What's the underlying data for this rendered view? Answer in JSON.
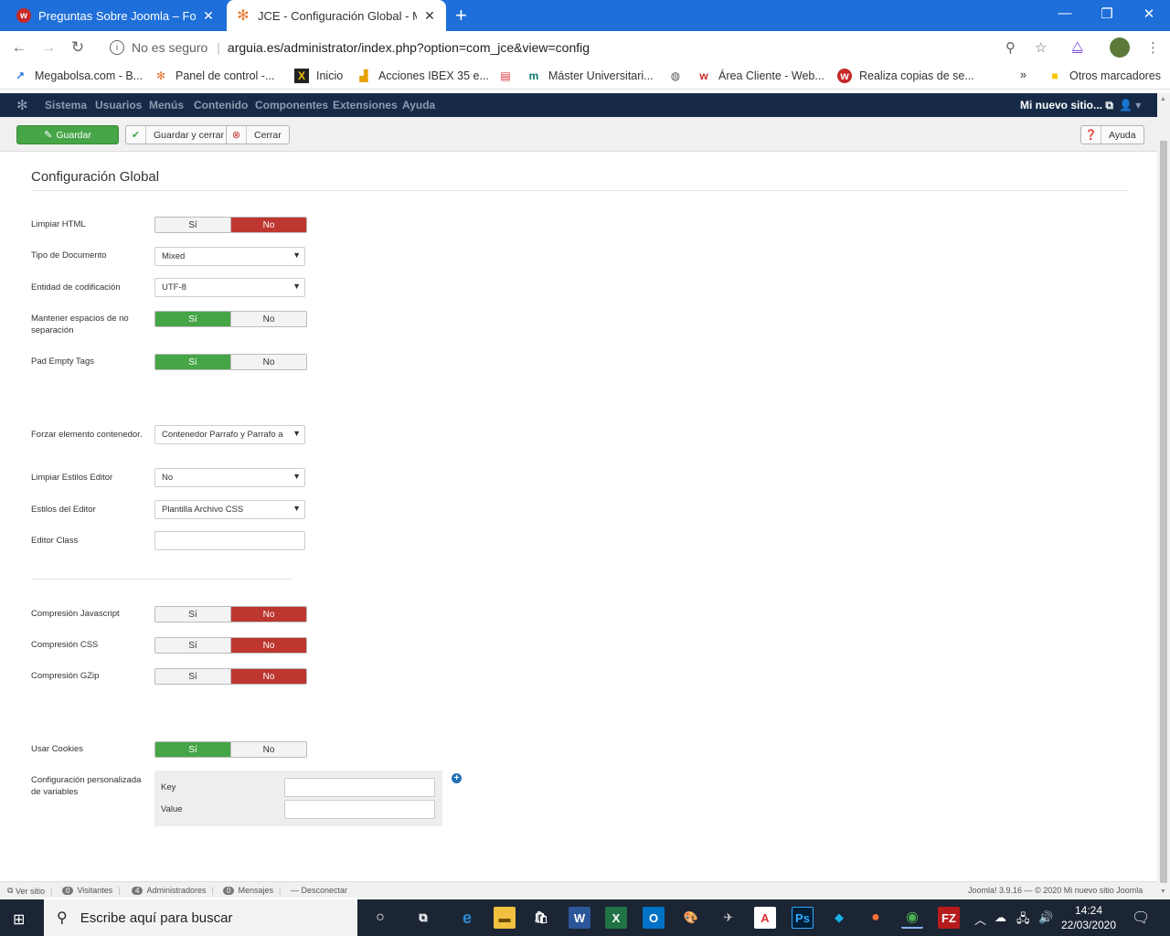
{
  "browser": {
    "tabs": [
      {
        "title": "Preguntas Sobre Joomla – Foro W",
        "active": false
      },
      {
        "title": "JCE - Configuración Global - Mi n",
        "active": true
      }
    ],
    "security_label": "No es seguro",
    "url": "arguia.es/administrator/index.php?option=com_jce&view=config",
    "bookmarks": [
      {
        "label": "Megabolsa.com - B..."
      },
      {
        "label": "Panel de control -..."
      },
      {
        "label": "Inicio"
      },
      {
        "label": "Acciones IBEX 35 e..."
      },
      {
        "label": ""
      },
      {
        "label": "Máster Universitari..."
      },
      {
        "label": ""
      },
      {
        "label": "Área Cliente - Web..."
      },
      {
        "label": "Realiza copias de se..."
      }
    ],
    "bookmarks_overflow": "»",
    "other_bookmarks": "Otros marcadores"
  },
  "joomla_nav": {
    "items": [
      "Sistema",
      "Usuarios",
      "Menús",
      "Contenido",
      "Componentes",
      "Extensiones",
      "Ayuda"
    ],
    "site_link": "Mi nuevo sitio..."
  },
  "toolbar": {
    "save": "Guardar",
    "save_close": "Guardar y cerrar",
    "close": "Cerrar",
    "help": "Ayuda"
  },
  "page": {
    "title": "Configuración Global"
  },
  "form": {
    "limpiar_html": {
      "label": "Limpiar HTML",
      "yes": "Sí",
      "no": "No",
      "value": "No"
    },
    "tipo_documento": {
      "label": "Tipo de Documento",
      "value": "Mixed"
    },
    "entidad_codificacion": {
      "label": "Entidad de codificación",
      "value": "UTF-8"
    },
    "mantener_espacios": {
      "label": "Mantener espacios de no separación",
      "yes": "Sí",
      "no": "No",
      "value": "Sí"
    },
    "pad_empty_tags": {
      "label": "Pad Empty Tags",
      "yes": "Sí",
      "no": "No",
      "value": "Sí"
    },
    "forzar_elemento": {
      "label": "Forzar elemento contenedor.",
      "value": "Contenedor Parrafo y Parrafo a"
    },
    "limpiar_estilos": {
      "label": "Limpiar Estilos Editor",
      "value": "No"
    },
    "estilos_editor": {
      "label": "Estilos del Editor",
      "value": "Plantilla Archivo CSS"
    },
    "editor_class": {
      "label": "Editor Class",
      "value": ""
    },
    "compresion_js": {
      "label": "Compresión Javascript",
      "yes": "Sí",
      "no": "No",
      "value": "No"
    },
    "compresion_css": {
      "label": "Compresión CSS",
      "yes": "Sí",
      "no": "No",
      "value": "No"
    },
    "compresion_gzip": {
      "label": "Compresión GZip",
      "yes": "Sí",
      "no": "No",
      "value": "No"
    },
    "usar_cookies": {
      "label": "Usar Cookies",
      "yes": "Sí",
      "no": "No",
      "value": "Sí"
    },
    "custom_vars": {
      "label": "Configuración personalizada de variables",
      "key_label": "Key",
      "value_label": "Value",
      "key": "",
      "value": ""
    }
  },
  "statusbar": {
    "view_site": "Ver sitio",
    "visitors_count": "0",
    "visitors": "Visitantes",
    "admins_count": "4",
    "admins": "Administradores",
    "messages_count": "0",
    "messages": "Mensajes",
    "logout": "Desconectar",
    "version": "Joomla! 3.9.16",
    "copyright": "© 2020 Mi nuevo sitio Joomla"
  },
  "taskbar": {
    "search_placeholder": "Escribe aquí para buscar",
    "time": "14:24",
    "date": "22/03/2020"
  },
  "colors": {
    "chrome_blue": "#1e6fd9",
    "joomla_nav": "#162a47",
    "yes_green": "#46a546",
    "no_red": "#bd362f"
  }
}
